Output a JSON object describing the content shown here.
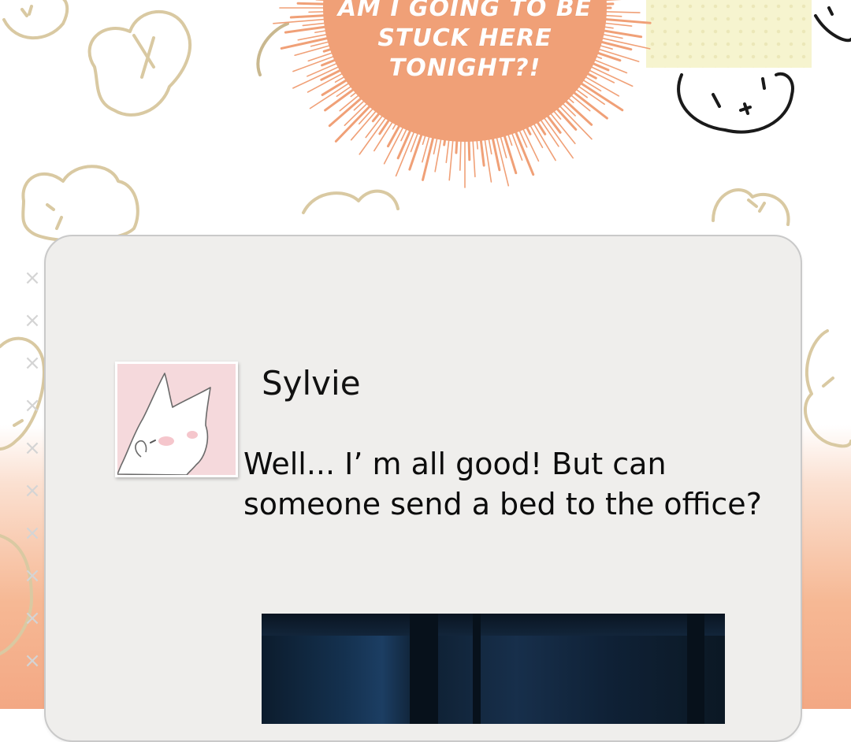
{
  "burst": {
    "line1": "AM I GOING TO BE",
    "line2": "STUCK HERE TONIGHT?!",
    "color": "#f0a077"
  },
  "post": {
    "author": "Sylvie",
    "message": "Well... I’ m all good! But can someone send a bed to the office?"
  },
  "side_marks": [
    "×",
    "×",
    "×",
    "×",
    "×",
    "×",
    "×",
    "×",
    "×",
    "×"
  ],
  "colors": {
    "card": "#efeeec",
    "avatar_bg": "#f5d9dc",
    "note": "#f6f4cf"
  },
  "icons": {
    "avatar": "white-cat-icon",
    "background": "bunny-doodle-icon"
  }
}
